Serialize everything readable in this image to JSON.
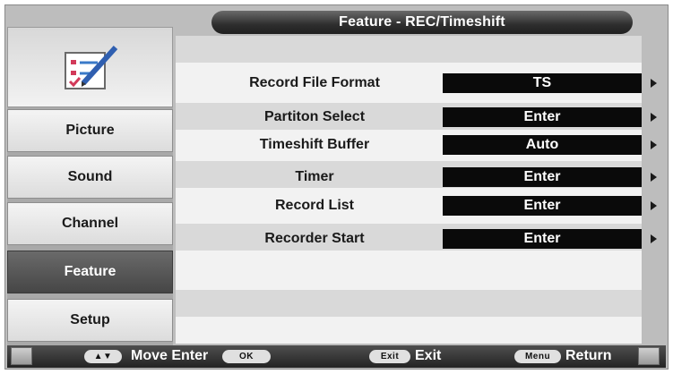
{
  "header": {
    "title": "Feature - REC/Timeshift"
  },
  "sidebar": {
    "logo_icon": "checklist-pencil-icon",
    "items": [
      {
        "label": "Picture",
        "active": false
      },
      {
        "label": "Sound",
        "active": false
      },
      {
        "label": "Channel",
        "active": false
      },
      {
        "label": "Feature",
        "active": true
      },
      {
        "label": "Setup",
        "active": false
      }
    ]
  },
  "settings": [
    {
      "label": "Record File Format",
      "value": "TS"
    },
    {
      "label": "Partiton Select",
      "value": "Enter"
    },
    {
      "label": "Timeshift Buffer",
      "value": "Auto"
    },
    {
      "label": "Timer",
      "value": "Enter"
    },
    {
      "label": "Record List",
      "value": "Enter"
    },
    {
      "label": "Recorder Start",
      "value": "Enter"
    }
  ],
  "footer": {
    "nav_key": "▲▼",
    "move_label": "Move Enter",
    "ok_key": "OK",
    "exit_key": "Exit",
    "exit_label": "Exit",
    "menu_key": "Menu",
    "return_label": "Return"
  },
  "colors": {
    "active_item_bg": "#555555",
    "value_box_bg": "#0a0a0a",
    "title_bar_bg": "#2e2e2e"
  }
}
